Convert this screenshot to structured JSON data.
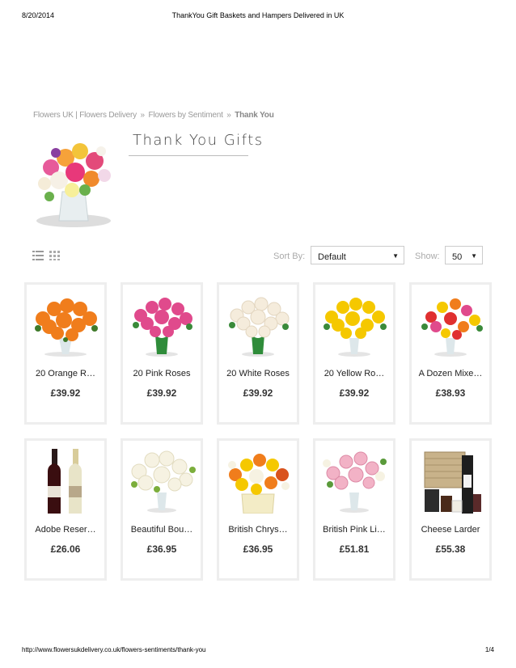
{
  "print": {
    "date": "8/20/2014",
    "doc_title": "ThankYou Gift Baskets and Hampers Delivered in UK",
    "url": "http://www.flowersukdelivery.co.uk/flowers-sentiments/thank-you",
    "page": "1/4"
  },
  "breadcrumb": {
    "home": "Flowers UK | Flowers Delivery",
    "sep": "»",
    "level2": "Flowers by Sentiment",
    "current": "Thank You"
  },
  "page_title": "Thank You Gifts",
  "toolbar": {
    "sort_label": "Sort By:",
    "sort_value": "Default",
    "show_label": "Show:",
    "show_value": "50",
    "caret": "▼"
  },
  "products": [
    {
      "name": "20 Orange R…",
      "price": "£39.92",
      "icon": "orange-roses-bouquet"
    },
    {
      "name": "20 Pink Roses",
      "price": "£39.92",
      "icon": "pink-roses-bouquet"
    },
    {
      "name": "20 White Roses",
      "price": "£39.92",
      "icon": "white-roses-bouquet"
    },
    {
      "name": "20 Yellow Ro…",
      "price": "£39.92",
      "icon": "yellow-roses-bouquet"
    },
    {
      "name": "A Dozen Mixe…",
      "price": "£38.93",
      "icon": "mixed-roses-bouquet"
    },
    {
      "name": "Adobe Reser…",
      "price": "£26.06",
      "icon": "wine-bottles"
    },
    {
      "name": "Beautiful Bou…",
      "price": "£36.95",
      "icon": "white-lilies-bouquet"
    },
    {
      "name": "British Chrys…",
      "price": "£36.95",
      "icon": "chrysanthemum-box"
    },
    {
      "name": "British Pink Li…",
      "price": "£51.81",
      "icon": "pink-lilies-bouquet"
    },
    {
      "name": "Cheese Larder",
      "price": "£55.38",
      "icon": "cheese-hamper"
    }
  ]
}
